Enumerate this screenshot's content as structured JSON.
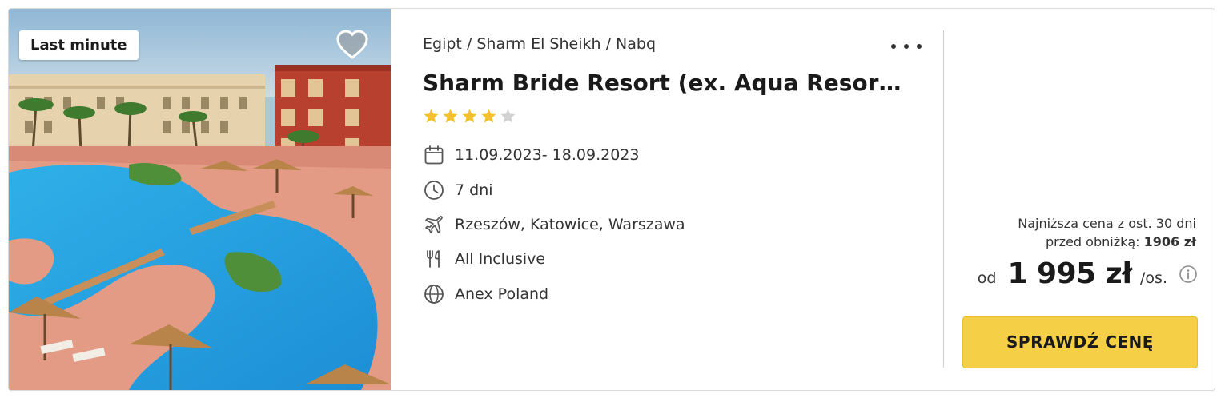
{
  "offer": {
    "badge": "Last minute",
    "breadcrumb": "Egipt / Sharm El Sheikh / Nabq",
    "title": "Sharm Bride Resort (ex. Aqua Resort …",
    "rating": {
      "value": 4,
      "max": 5
    },
    "dates": "11.09.2023- 18.09.2023",
    "duration": "7 dni",
    "departure": "Rzeszów, Katowice, Warszawa",
    "board": "All Inclusive",
    "operator": "Anex Poland"
  },
  "price": {
    "lowest_label": "Najniższa cena z ost. 30 dni",
    "before_discount_label": "przed obniżką:",
    "before_discount_value": "1906 zł",
    "prefix": "od",
    "amount": "1 995 zł",
    "unit": "/os.",
    "cta": "SPRAWDŹ CENĘ"
  },
  "icons": {
    "favorite": "heart-icon",
    "more": "more-dots-icon",
    "star": "star-icon",
    "dates": "calendar-icon",
    "duration": "clock-icon",
    "departure": "plane-icon",
    "board": "cutlery-icon",
    "operator": "globe-icon",
    "info": "info-icon"
  },
  "colors": {
    "star_filled": "#f5c02f",
    "star_empty": "#d2d2d2",
    "cta_background": "#f5cf45"
  }
}
